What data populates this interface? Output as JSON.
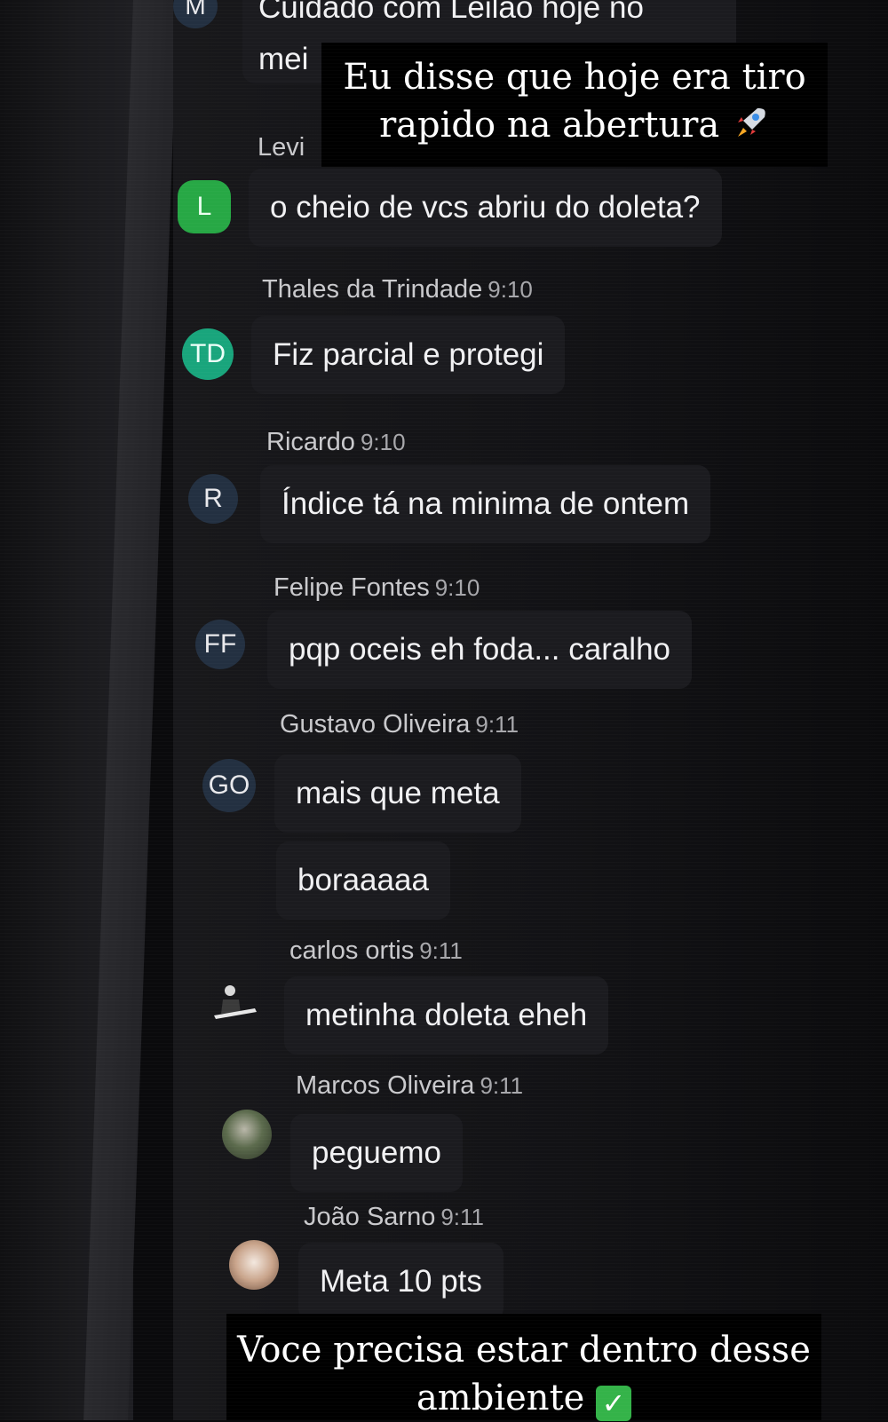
{
  "top_message": {
    "avatar_initial": "M",
    "text_line1": "Cuidado com Leilão hoje no",
    "text_line2": "mei"
  },
  "overlay_top": {
    "line1": "Eu disse que hoje era tiro",
    "line2": "rapido na abertura",
    "emoji": "rocket-icon"
  },
  "messages": [
    {
      "author": "Levi",
      "time": "",
      "avatar": "L",
      "text": "o cheio de vcs abriu do doleta?"
    },
    {
      "author": "Thales da Trindade",
      "time": "9:10",
      "avatar": "TD",
      "text": "Fiz parcial e protegi"
    },
    {
      "author": "Ricardo",
      "time": "9:10",
      "avatar": "R",
      "text": "Índice tá na minima de ontem"
    },
    {
      "author": "Felipe Fontes",
      "time": "9:10",
      "avatar": "FF",
      "text": "pqp oceis eh foda... caralho"
    },
    {
      "author": "Gustavo Oliveira",
      "time": "9:11",
      "avatar": "GO",
      "text": "mais que meta",
      "text2": "boraaaaa"
    },
    {
      "author": "carlos ortis",
      "time": "9:11",
      "avatar": "",
      "text": "metinha doleta eheh"
    },
    {
      "author": "Marcos Oliveira",
      "time": "9:11",
      "avatar": "",
      "text": "peguemo"
    },
    {
      "author": "João Sarno",
      "time": "9:11",
      "avatar": "",
      "text": "Meta 10 pts"
    }
  ],
  "overlay_bottom": {
    "line1": "Voce precisa estar dentro desse",
    "line2": "ambiente",
    "emoji_char": "✓"
  }
}
